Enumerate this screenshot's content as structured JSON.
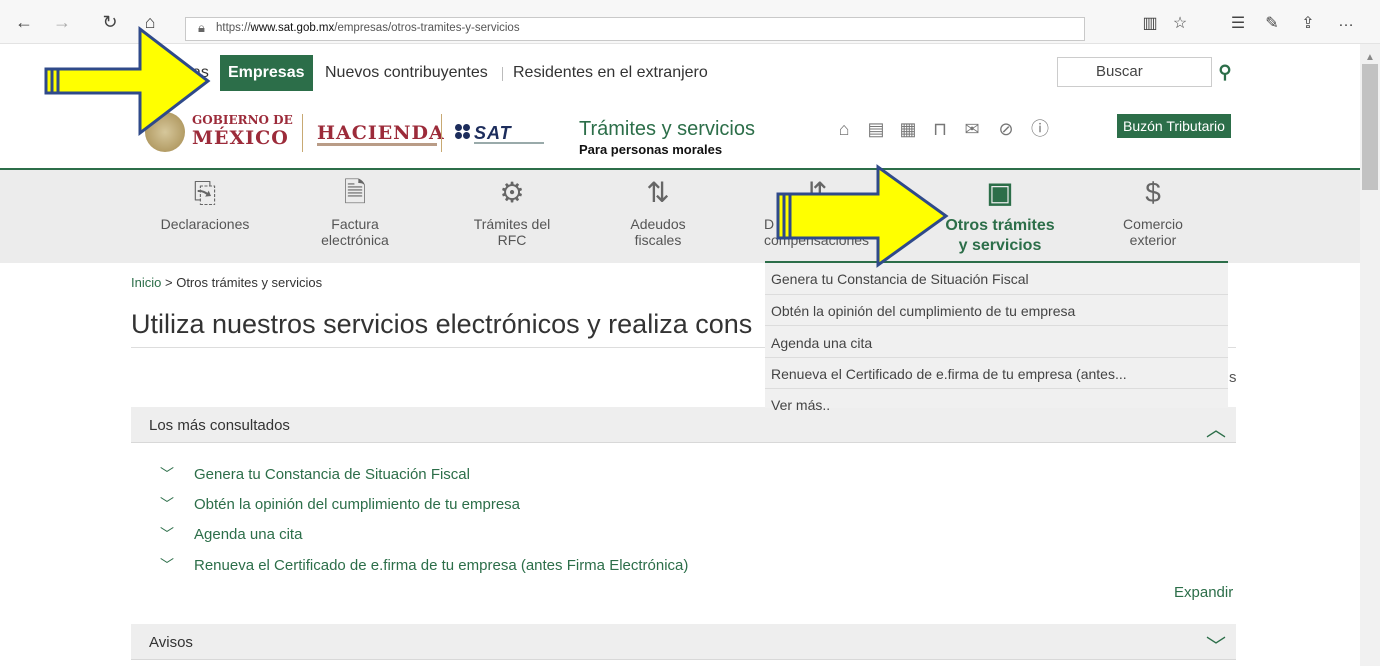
{
  "browser": {
    "url_prefix": "https://",
    "url_domain": "www.sat.gob.mx",
    "url_path": "/empresas/otros-tramites-y-servicios"
  },
  "topnav": {
    "partial_item": "as",
    "active_item": "Empresas",
    "item_nuevos": "Nuevos contribuyentes",
    "item_residentes": "Residentes en el extranjero",
    "search_placeholder": "Buscar"
  },
  "header": {
    "gobierno_line1": "GOBIERNO DE",
    "gobierno_line2": "MÉXICO",
    "hacienda": "HACIENDA",
    "sat": "SAT",
    "title": "Trámites y servicios",
    "subtitle": "Para personas morales",
    "buzon": "Buzón Tributario"
  },
  "categories": {
    "declaraciones": "Declaraciones",
    "factura_1": "Factura",
    "factura_2": "electrónica",
    "rfc_1": "Trámites del",
    "rfc_2": "RFC",
    "adeudos_1": "Adeudos",
    "adeudos_2": "fiscales",
    "devol_1": "D",
    "devol_2": "compensaciones",
    "otros_1": "Otros trámites",
    "otros_2": "y servicios",
    "comercio_1": "Comercio",
    "comercio_2": "exterior"
  },
  "dropdown": {
    "items": [
      "Genera tu Constancia de Situación Fiscal",
      "Obtén la opinión del cumplimiento de tu empresa",
      "Agenda una cita",
      "Renueva el Certificado de e.firma de tu empresa (antes...",
      "Ver más.."
    ]
  },
  "breadcrumb": {
    "home": "Inicio",
    "separator": ">",
    "current": "Otros trámites y servicios"
  },
  "main": {
    "title": "Utiliza nuestros servicios electrónicos y realiza cons",
    "stray_letter": "s"
  },
  "panel_consultados": {
    "label": "Los más consultados",
    "items": [
      "Genera tu Constancia de Situación Fiscal",
      "Obtén la opinión del cumplimiento de tu empresa",
      "Agenda una cita",
      "Renueva el Certificado de e.firma de tu empresa (antes Firma Electrónica)"
    ],
    "expand": "Expandir"
  },
  "panel_avisos": {
    "label": "Avisos"
  },
  "colors": {
    "brand_green": "#2c6e49",
    "arrow_yellow": "#ffff00",
    "arrow_outline": "#2f4a8a"
  },
  "icons": [
    "back-icon",
    "forward-icon",
    "refresh-icon",
    "home-icon",
    "lock-icon",
    "reading-view-icon",
    "favorite-star-icon",
    "favorites-list-icon",
    "pen-icon",
    "share-icon",
    "more-icon"
  ]
}
